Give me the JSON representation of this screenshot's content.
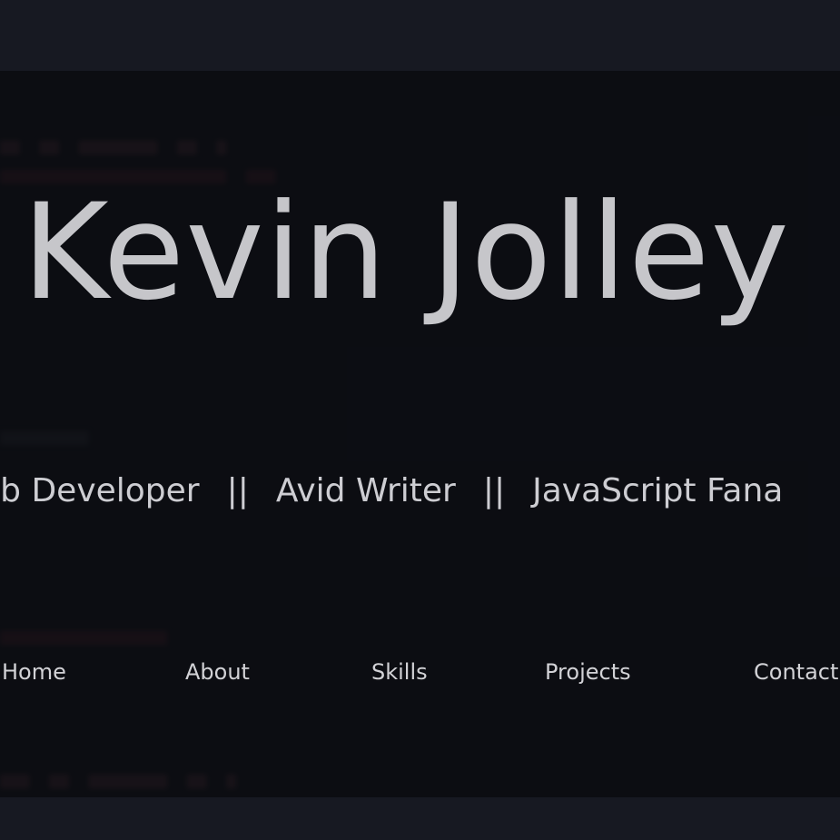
{
  "header": {
    "name": "Kevin Jolley",
    "tagline": [
      "eb Developer",
      "||",
      "Avid Writer",
      "||",
      "JavaScript Fana"
    ]
  },
  "nav": {
    "items": [
      "Home",
      "About",
      "Skills",
      "Projects",
      "Contact"
    ]
  },
  "colors": {
    "background": "#0a0b10",
    "band": "#171922",
    "title_text": "#c6c6ca",
    "nav_text": "#d2d2d6"
  }
}
